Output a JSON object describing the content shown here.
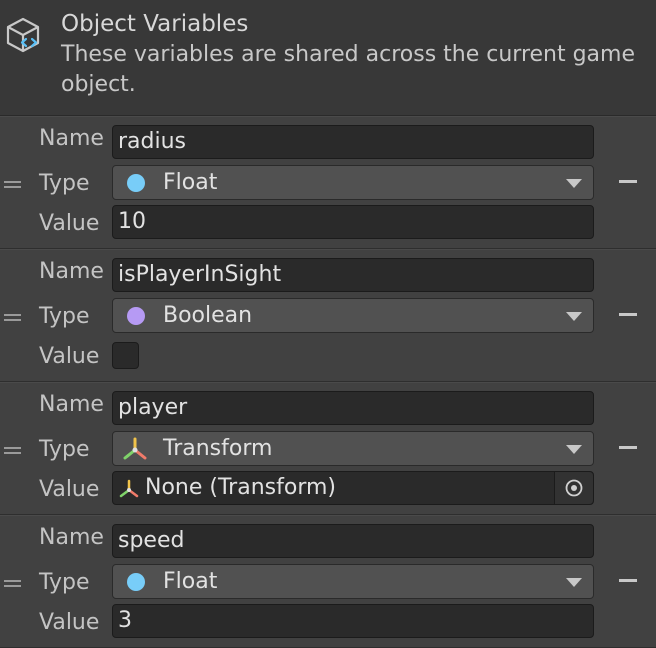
{
  "header": {
    "title": "Object Variables",
    "description": "These variables are shared across the current game object."
  },
  "labels": {
    "name": "Name",
    "type": "Type",
    "value": "Value"
  },
  "variables": [
    {
      "name": "radius",
      "type": "Float",
      "type_color": "#78cdf8",
      "value": "10"
    },
    {
      "name": "isPlayerInSight",
      "type": "Boolean",
      "type_color": "#b69af4",
      "value_checked": false
    },
    {
      "name": "player",
      "type": "Transform",
      "type_icon": "transform-icon",
      "value": "None (Transform)"
    },
    {
      "name": "speed",
      "type": "Float",
      "type_color": "#78cdf8",
      "value": "3"
    }
  ]
}
